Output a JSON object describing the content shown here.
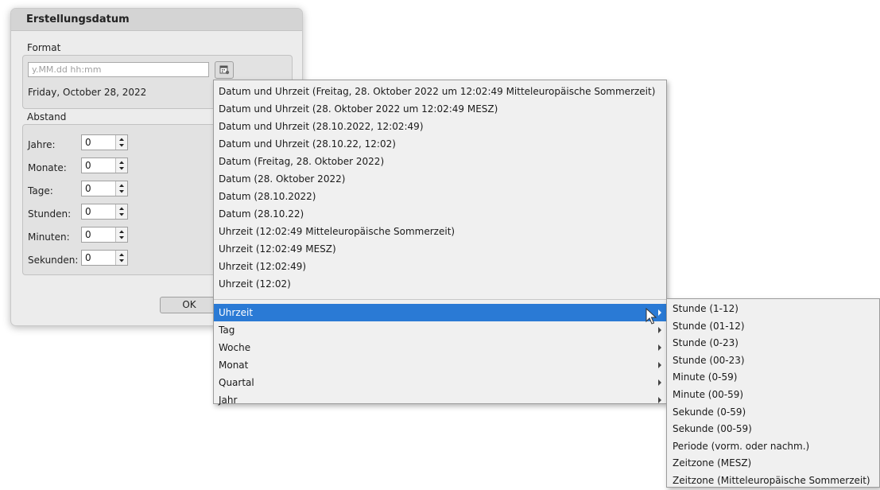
{
  "dialog": {
    "title": "Erstellungsdatum",
    "format_label": "Format",
    "format_placeholder": "y.MM.dd hh:mm",
    "preview": "Friday, October 28, 2022",
    "offset_label": "Abstand",
    "fields": [
      {
        "label": "Jahre:",
        "value": "0"
      },
      {
        "label": "Monate:",
        "value": "0"
      },
      {
        "label": "Tage:",
        "value": "0"
      },
      {
        "label": "Stunden:",
        "value": "0"
      },
      {
        "label": "Minuten:",
        "value": "0"
      },
      {
        "label": "Sekunden:",
        "value": "0"
      }
    ],
    "ok_label": "OK"
  },
  "menu": {
    "presets": [
      "Datum und Uhrzeit (Freitag, 28. Oktober 2022 um 12:02:49 Mitteleuropäische Sommerzeit)",
      "Datum und Uhrzeit (28. Oktober 2022 um 12:02:49 MESZ)",
      "Datum und Uhrzeit (28.10.2022, 12:02:49)",
      "Datum und Uhrzeit (28.10.22, 12:02)",
      "Datum (Freitag, 28. Oktober 2022)",
      "Datum (28. Oktober 2022)",
      "Datum (28.10.2022)",
      "Datum (28.10.22)",
      "Uhrzeit (12:02:49 Mitteleuropäische Sommerzeit)",
      "Uhrzeit (12:02:49 MESZ)",
      "Uhrzeit (12:02:49)",
      "Uhrzeit (12:02)"
    ],
    "groups": [
      "Uhrzeit",
      "Tag",
      "Woche",
      "Monat",
      "Quartal",
      "Jahr"
    ],
    "highlighted_group": "Uhrzeit"
  },
  "submenu": {
    "items": [
      "Stunde (1-12)",
      "Stunde (01-12)",
      "Stunde (0-23)",
      "Stunde (00-23)",
      "Minute (0-59)",
      "Minute (00-59)",
      "Sekunde (0-59)",
      "Sekunde (00-59)",
      "Periode (vorm. oder nachm.)",
      "Zeitzone (MESZ)",
      "Zeitzone (Mitteleuropäische Sommerzeit)"
    ]
  },
  "colors": {
    "highlight": "#2a7ad5",
    "dialog_bg": "#ececec",
    "menu_bg": "#f0f0f0"
  }
}
